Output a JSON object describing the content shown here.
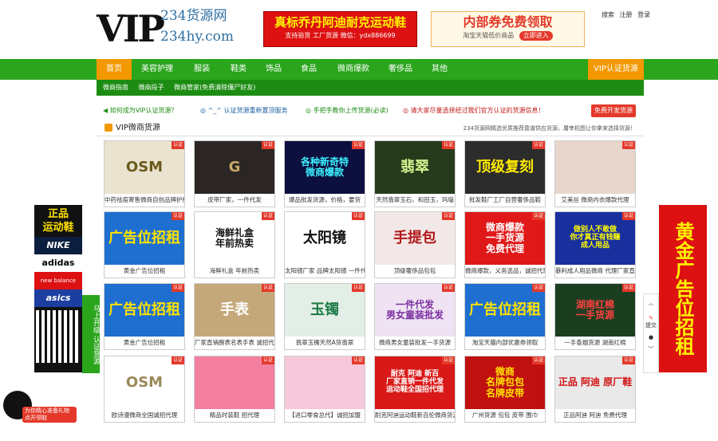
{
  "header": {
    "logo_main": "VIP",
    "logo_line1": "234货源网",
    "logo_line2": "234hy.com",
    "banner1_title": "真标乔丹阿迪耐克运动鞋",
    "banner1_sub": "支持验货 工厂货源 微信：ydx886699",
    "banner2_title": "内部券免费领取",
    "banner2_sub": "淘宝天猫低价商品",
    "banner2_btn": "立即进入",
    "links": [
      "搜索",
      "注册",
      "登录"
    ]
  },
  "nav": {
    "items": [
      "首页",
      "美容护理",
      "服装",
      "鞋类",
      "饰品",
      "食品",
      "微商爆款",
      "奢侈品",
      "其他"
    ],
    "vip": "VIP认证货源",
    "sub": [
      "微商指南",
      "微商段子",
      "微商管家(免费清除僵尸好友)"
    ]
  },
  "notices": [
    "如何成为VIP认证货源？",
    "^_^ 认证货源重新置顶服务",
    "手把手教你上传货源(必读)",
    "请大家尽量选择经过我们官方认证的货源信息！"
  ],
  "notice_btn": "免费开发货源",
  "section": {
    "title": "VIP微商货源",
    "desc": "234货源网精选优质推荐靠谱供应货源，屠宰机图让你拿来选择货源！"
  },
  "badge": "认证",
  "cards": [
    {
      "img": "OSM",
      "cap": "中药祛痘寄售微商自创品牌护肤生产",
      "bg": "#e9e3cf",
      "fg": "#6b5a1c"
    },
    {
      "img": "G",
      "cap": "皮带厂家，一件代发",
      "bg": "#2b2623",
      "fg": "#c9a86a"
    },
    {
      "img": "各种新奇特\n微商爆款",
      "cap": "爆品批发货源，价格，要货",
      "bg": "#0d0f3f",
      "fg": "#3cf0ff"
    },
    {
      "img": "翡翠",
      "cap": "天然翡翠玉石，和田玉，玛瑙",
      "bg": "#263b1c",
      "fg": "#d4f28f"
    },
    {
      "img": "顶级复刻",
      "cap": "批发鞋厂工厂自营奢侈品鞋",
      "bg": "#2c2c2c",
      "fg": "#ffea00"
    },
    {
      "img": "",
      "cap": "艾美丝 微商内衣爆款代理",
      "bg": "#e7d6cc",
      "fg": "#a03050"
    },
    {
      "img": "广告位招租",
      "cap": "黄金广告位招租",
      "bg": "#1f6fd0",
      "fg": "#ffe200"
    },
    {
      "img": "海鲜礼盒\n年前热卖",
      "cap": "海鲜礼盒 年前热卖",
      "bg": "#ffffff",
      "fg": "#111111"
    },
    {
      "img": "太阳镜",
      "cap": "太阳镜厂家 品牌太阳镜 一件代发",
      "bg": "#ffffff",
      "fg": "#111111"
    },
    {
      "img": "手提包",
      "cap": "顶级奢侈品包包",
      "bg": "#f3e8e8",
      "fg": "#b01818"
    },
    {
      "img": "微商爆款\n一手货源\n免费代理",
      "cap": "微商爆款，义务选品，诚招代理",
      "bg": "#e01818",
      "fg": "#ffffff"
    },
    {
      "img": "做别人不敢做\n你才真正有钱赚\n成人用品",
      "cap": "暴利成人用品微商 代理厂家直销",
      "bg": "#1a2f9e",
      "fg": "#ffff00"
    },
    {
      "img": "广告位招租",
      "cap": "黄金广告位招租",
      "bg": "#1f6fd0",
      "fg": "#ffe200"
    },
    {
      "img": "手表",
      "cap": "厂家直销腕表名表手表 诚招代理",
      "bg": "#c5a87a",
      "fg": "#ffffff"
    },
    {
      "img": "玉镯",
      "cap": "翡翠玉镯天然A货翡翠",
      "bg": "#e3efe6",
      "fg": "#1c7a44"
    },
    {
      "img": "一件代发\n男女童装批发",
      "cap": "微商男女童装批发一手货源",
      "bg": "#efe3f3",
      "fg": "#7a2fa0"
    },
    {
      "img": "广告位招租",
      "cap": "淘宝天猫内部优惠券领取",
      "bg": "#1f6fd0",
      "fg": "#ffe200"
    },
    {
      "img": "湖南红棉\n一手货源",
      "cap": "一手香烟货源 湖南红棉",
      "bg": "#1c3e20",
      "fg": "#ff4040"
    },
    {
      "img": "OSM",
      "cap": "欧诗漫微商全国诚招代理",
      "bg": "#ffffff",
      "fg": "#9a8a5a"
    },
    {
      "img": "",
      "cap": "精品时装鞋 招代理",
      "bg": "#f27fa0",
      "fg": "#ffffff"
    },
    {
      "img": "",
      "cap": "【进口零食总代】诚招加盟",
      "bg": "#f6c8dc",
      "fg": "#c01870"
    },
    {
      "img": "耐克 阿迪 新百\n厂家直销一件代发\n运动鞋全国招代理",
      "cap": "耐克阿迪运动鞋新百伦微商货源",
      "bg": "#d91818",
      "fg": "#ffffff"
    },
    {
      "img": "微商\n名牌包包\n名牌皮带",
      "cap": "广州货源 包包 皮带 围巾",
      "bg": "#c01010",
      "fg": "#ffe200"
    },
    {
      "img": "正品 阿迪 原厂鞋",
      "cap": "正品阿迪 阿迪 免费代理",
      "bg": "#e9e9e9",
      "fg": "#d11111"
    }
  ],
  "left_ad": {
    "top": "正品\n运动鞋",
    "brands": [
      "NIKE",
      "adidas",
      "new balance",
      "asics"
    ],
    "float": "马上开级 认证货源"
  },
  "right_ad": "黄金广告位招租",
  "right_tools": [
    "提交"
  ],
  "qq_float": "为你精心准备礼物 点开领取"
}
